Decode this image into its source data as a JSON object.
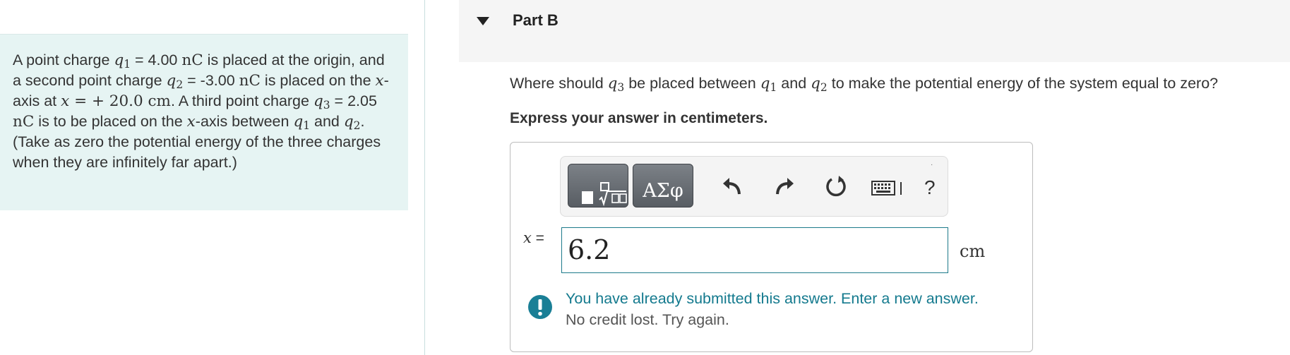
{
  "problem": {
    "p1": "A point charge ",
    "q1_var": "q",
    "q1_sub": "1",
    "p2": " = 4.00 ",
    "nC1": "nC",
    "p3": " is placed at the origin, and a second point charge ",
    "q2_var": "q",
    "q2_sub": "2",
    "p4": " = -3.00 ",
    "nC2": "nC",
    "p5": " is placed on the ",
    "x1": "x",
    "p6": "-axis at ",
    "x2": "x",
    "pos": " = + 20.0 ",
    "cm": "cm",
    "p7": ". A third point charge ",
    "q3_var": "q",
    "q3_sub": "3",
    "p8": " = 2.05 ",
    "nC3": "nC",
    "p9": " is to be placed on the ",
    "x3": "x",
    "p10": "-axis between ",
    "q1b_var": "q",
    "q1b_sub": "1",
    "p11": " and ",
    "q2b_var": "q",
    "q2b_sub": "2",
    "p12": ". (Take as zero the potential energy of the three charges when they are infinitely far apart.)"
  },
  "part": {
    "title": "Part B"
  },
  "question": {
    "t1": "Where should ",
    "q3": "q",
    "q3_sub": "3",
    "t2": " be placed between ",
    "q1": "q",
    "q1_sub": "1",
    "t3": " and ",
    "q2": "q",
    "q2_sub": "2",
    "t4": " to make the potential energy of the system equal to zero?"
  },
  "instruction": "Express your answer in centimeters.",
  "toolbar": {
    "symbols_label": "ΑΣφ",
    "help_label": "?",
    "dot": "·",
    "icons": [
      "templates-icon",
      "undo-icon",
      "redo-icon",
      "reset-icon",
      "keyboard-icon",
      "help-icon"
    ]
  },
  "answer": {
    "variable": "x",
    "equals": " =",
    "value": "6.2",
    "unit": "cm"
  },
  "feedback": {
    "line1": "You have already submitted this answer. Enter a new answer.",
    "line2": "No credit lost. Try again."
  },
  "colors": {
    "panel_bg": "#e6f4f3",
    "accent": "#147a8e",
    "alert": "#1a7f96"
  }
}
